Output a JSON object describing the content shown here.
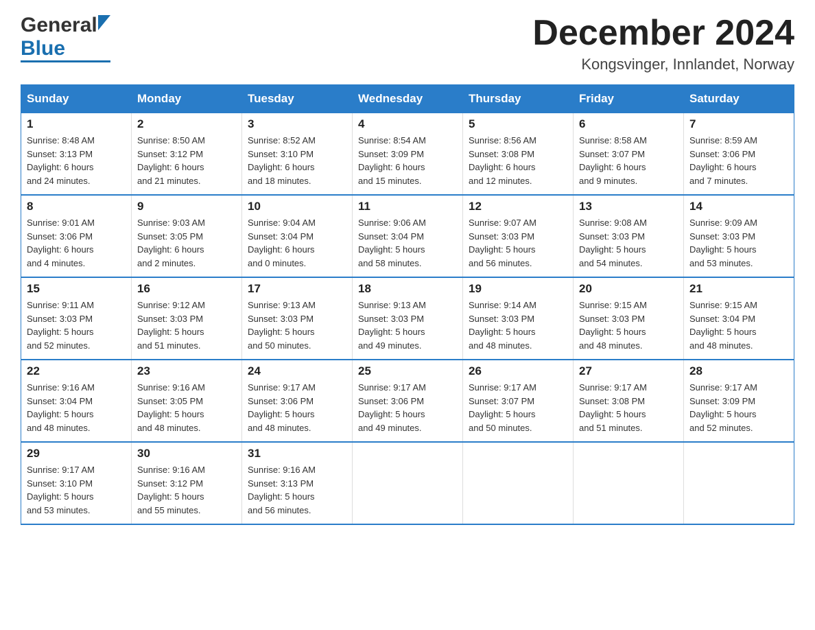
{
  "logo": {
    "general": "General",
    "blue": "Blue"
  },
  "header": {
    "title": "December 2024",
    "location": "Kongsvinger, Innlandet, Norway"
  },
  "columns": [
    "Sunday",
    "Monday",
    "Tuesday",
    "Wednesday",
    "Thursday",
    "Friday",
    "Saturday"
  ],
  "weeks": [
    [
      {
        "day": "1",
        "info": "Sunrise: 8:48 AM\nSunset: 3:13 PM\nDaylight: 6 hours\nand 24 minutes."
      },
      {
        "day": "2",
        "info": "Sunrise: 8:50 AM\nSunset: 3:12 PM\nDaylight: 6 hours\nand 21 minutes."
      },
      {
        "day": "3",
        "info": "Sunrise: 8:52 AM\nSunset: 3:10 PM\nDaylight: 6 hours\nand 18 minutes."
      },
      {
        "day": "4",
        "info": "Sunrise: 8:54 AM\nSunset: 3:09 PM\nDaylight: 6 hours\nand 15 minutes."
      },
      {
        "day": "5",
        "info": "Sunrise: 8:56 AM\nSunset: 3:08 PM\nDaylight: 6 hours\nand 12 minutes."
      },
      {
        "day": "6",
        "info": "Sunrise: 8:58 AM\nSunset: 3:07 PM\nDaylight: 6 hours\nand 9 minutes."
      },
      {
        "day": "7",
        "info": "Sunrise: 8:59 AM\nSunset: 3:06 PM\nDaylight: 6 hours\nand 7 minutes."
      }
    ],
    [
      {
        "day": "8",
        "info": "Sunrise: 9:01 AM\nSunset: 3:06 PM\nDaylight: 6 hours\nand 4 minutes."
      },
      {
        "day": "9",
        "info": "Sunrise: 9:03 AM\nSunset: 3:05 PM\nDaylight: 6 hours\nand 2 minutes."
      },
      {
        "day": "10",
        "info": "Sunrise: 9:04 AM\nSunset: 3:04 PM\nDaylight: 6 hours\nand 0 minutes."
      },
      {
        "day": "11",
        "info": "Sunrise: 9:06 AM\nSunset: 3:04 PM\nDaylight: 5 hours\nand 58 minutes."
      },
      {
        "day": "12",
        "info": "Sunrise: 9:07 AM\nSunset: 3:03 PM\nDaylight: 5 hours\nand 56 minutes."
      },
      {
        "day": "13",
        "info": "Sunrise: 9:08 AM\nSunset: 3:03 PM\nDaylight: 5 hours\nand 54 minutes."
      },
      {
        "day": "14",
        "info": "Sunrise: 9:09 AM\nSunset: 3:03 PM\nDaylight: 5 hours\nand 53 minutes."
      }
    ],
    [
      {
        "day": "15",
        "info": "Sunrise: 9:11 AM\nSunset: 3:03 PM\nDaylight: 5 hours\nand 52 minutes."
      },
      {
        "day": "16",
        "info": "Sunrise: 9:12 AM\nSunset: 3:03 PM\nDaylight: 5 hours\nand 51 minutes."
      },
      {
        "day": "17",
        "info": "Sunrise: 9:13 AM\nSunset: 3:03 PM\nDaylight: 5 hours\nand 50 minutes."
      },
      {
        "day": "18",
        "info": "Sunrise: 9:13 AM\nSunset: 3:03 PM\nDaylight: 5 hours\nand 49 minutes."
      },
      {
        "day": "19",
        "info": "Sunrise: 9:14 AM\nSunset: 3:03 PM\nDaylight: 5 hours\nand 48 minutes."
      },
      {
        "day": "20",
        "info": "Sunrise: 9:15 AM\nSunset: 3:03 PM\nDaylight: 5 hours\nand 48 minutes."
      },
      {
        "day": "21",
        "info": "Sunrise: 9:15 AM\nSunset: 3:04 PM\nDaylight: 5 hours\nand 48 minutes."
      }
    ],
    [
      {
        "day": "22",
        "info": "Sunrise: 9:16 AM\nSunset: 3:04 PM\nDaylight: 5 hours\nand 48 minutes."
      },
      {
        "day": "23",
        "info": "Sunrise: 9:16 AM\nSunset: 3:05 PM\nDaylight: 5 hours\nand 48 minutes."
      },
      {
        "day": "24",
        "info": "Sunrise: 9:17 AM\nSunset: 3:06 PM\nDaylight: 5 hours\nand 48 minutes."
      },
      {
        "day": "25",
        "info": "Sunrise: 9:17 AM\nSunset: 3:06 PM\nDaylight: 5 hours\nand 49 minutes."
      },
      {
        "day": "26",
        "info": "Sunrise: 9:17 AM\nSunset: 3:07 PM\nDaylight: 5 hours\nand 50 minutes."
      },
      {
        "day": "27",
        "info": "Sunrise: 9:17 AM\nSunset: 3:08 PM\nDaylight: 5 hours\nand 51 minutes."
      },
      {
        "day": "28",
        "info": "Sunrise: 9:17 AM\nSunset: 3:09 PM\nDaylight: 5 hours\nand 52 minutes."
      }
    ],
    [
      {
        "day": "29",
        "info": "Sunrise: 9:17 AM\nSunset: 3:10 PM\nDaylight: 5 hours\nand 53 minutes."
      },
      {
        "day": "30",
        "info": "Sunrise: 9:16 AM\nSunset: 3:12 PM\nDaylight: 5 hours\nand 55 minutes."
      },
      {
        "day": "31",
        "info": "Sunrise: 9:16 AM\nSunset: 3:13 PM\nDaylight: 5 hours\nand 56 minutes."
      },
      {
        "day": "",
        "info": ""
      },
      {
        "day": "",
        "info": ""
      },
      {
        "day": "",
        "info": ""
      },
      {
        "day": "",
        "info": ""
      }
    ]
  ]
}
